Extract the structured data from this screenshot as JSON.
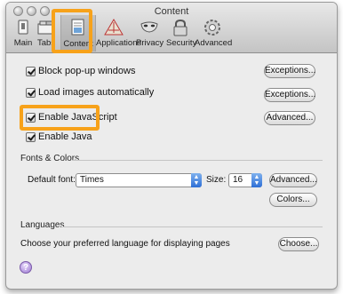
{
  "window": {
    "title": "Content"
  },
  "toolbar": {
    "items": [
      {
        "label": "Main",
        "icon": "main-switch-icon"
      },
      {
        "label": "Tabs",
        "icon": "tabs-icon"
      },
      {
        "label": "Content",
        "icon": "content-icon",
        "selected": true
      },
      {
        "label": "Applications",
        "icon": "applications-icon"
      },
      {
        "label": "Privacy",
        "icon": "privacy-mask-icon"
      },
      {
        "label": "Security",
        "icon": "lock-icon"
      },
      {
        "label": "Advanced",
        "icon": "gear-icon"
      }
    ]
  },
  "options": [
    {
      "label": "Block pop-up windows",
      "checked": true,
      "button": "Exceptions..."
    },
    {
      "label": "Load images automatically",
      "checked": true,
      "button": "Exceptions..."
    },
    {
      "label": "Enable JavaScript",
      "checked": true,
      "button": "Advanced..."
    },
    {
      "label": "Enable Java",
      "checked": true
    }
  ],
  "fonts_colors": {
    "heading": "Fonts & Colors",
    "default_font_label": "Default font:",
    "default_font_value": "Times",
    "size_label": "Size:",
    "size_value": "16",
    "advanced_button": "Advanced...",
    "colors_button": "Colors..."
  },
  "languages": {
    "heading": "Languages",
    "description": "Choose your preferred language for displaying pages",
    "choose_button": "Choose..."
  },
  "help": {
    "label": "?"
  },
  "colors": {
    "highlight": "#f7a21a",
    "popup_arrow": "#2f6fd6"
  }
}
